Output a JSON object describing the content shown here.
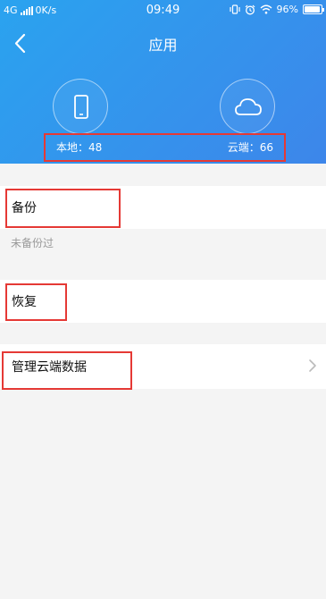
{
  "status_bar": {
    "network": "4G",
    "speed": "0K/s",
    "time": "09:49",
    "battery": "96%",
    "battery_level": 0.96
  },
  "header": {
    "title": "应用",
    "local_count": "本地：48",
    "cloud_count": "云端：66"
  },
  "backup": {
    "label": "备份",
    "status": "未备份过"
  },
  "restore": {
    "label": "恢复"
  },
  "manage": {
    "label": "管理云端数据"
  },
  "colors": {
    "header_start": "#2aa3ef",
    "header_end": "#3d86ea",
    "highlight": "#e53935"
  }
}
